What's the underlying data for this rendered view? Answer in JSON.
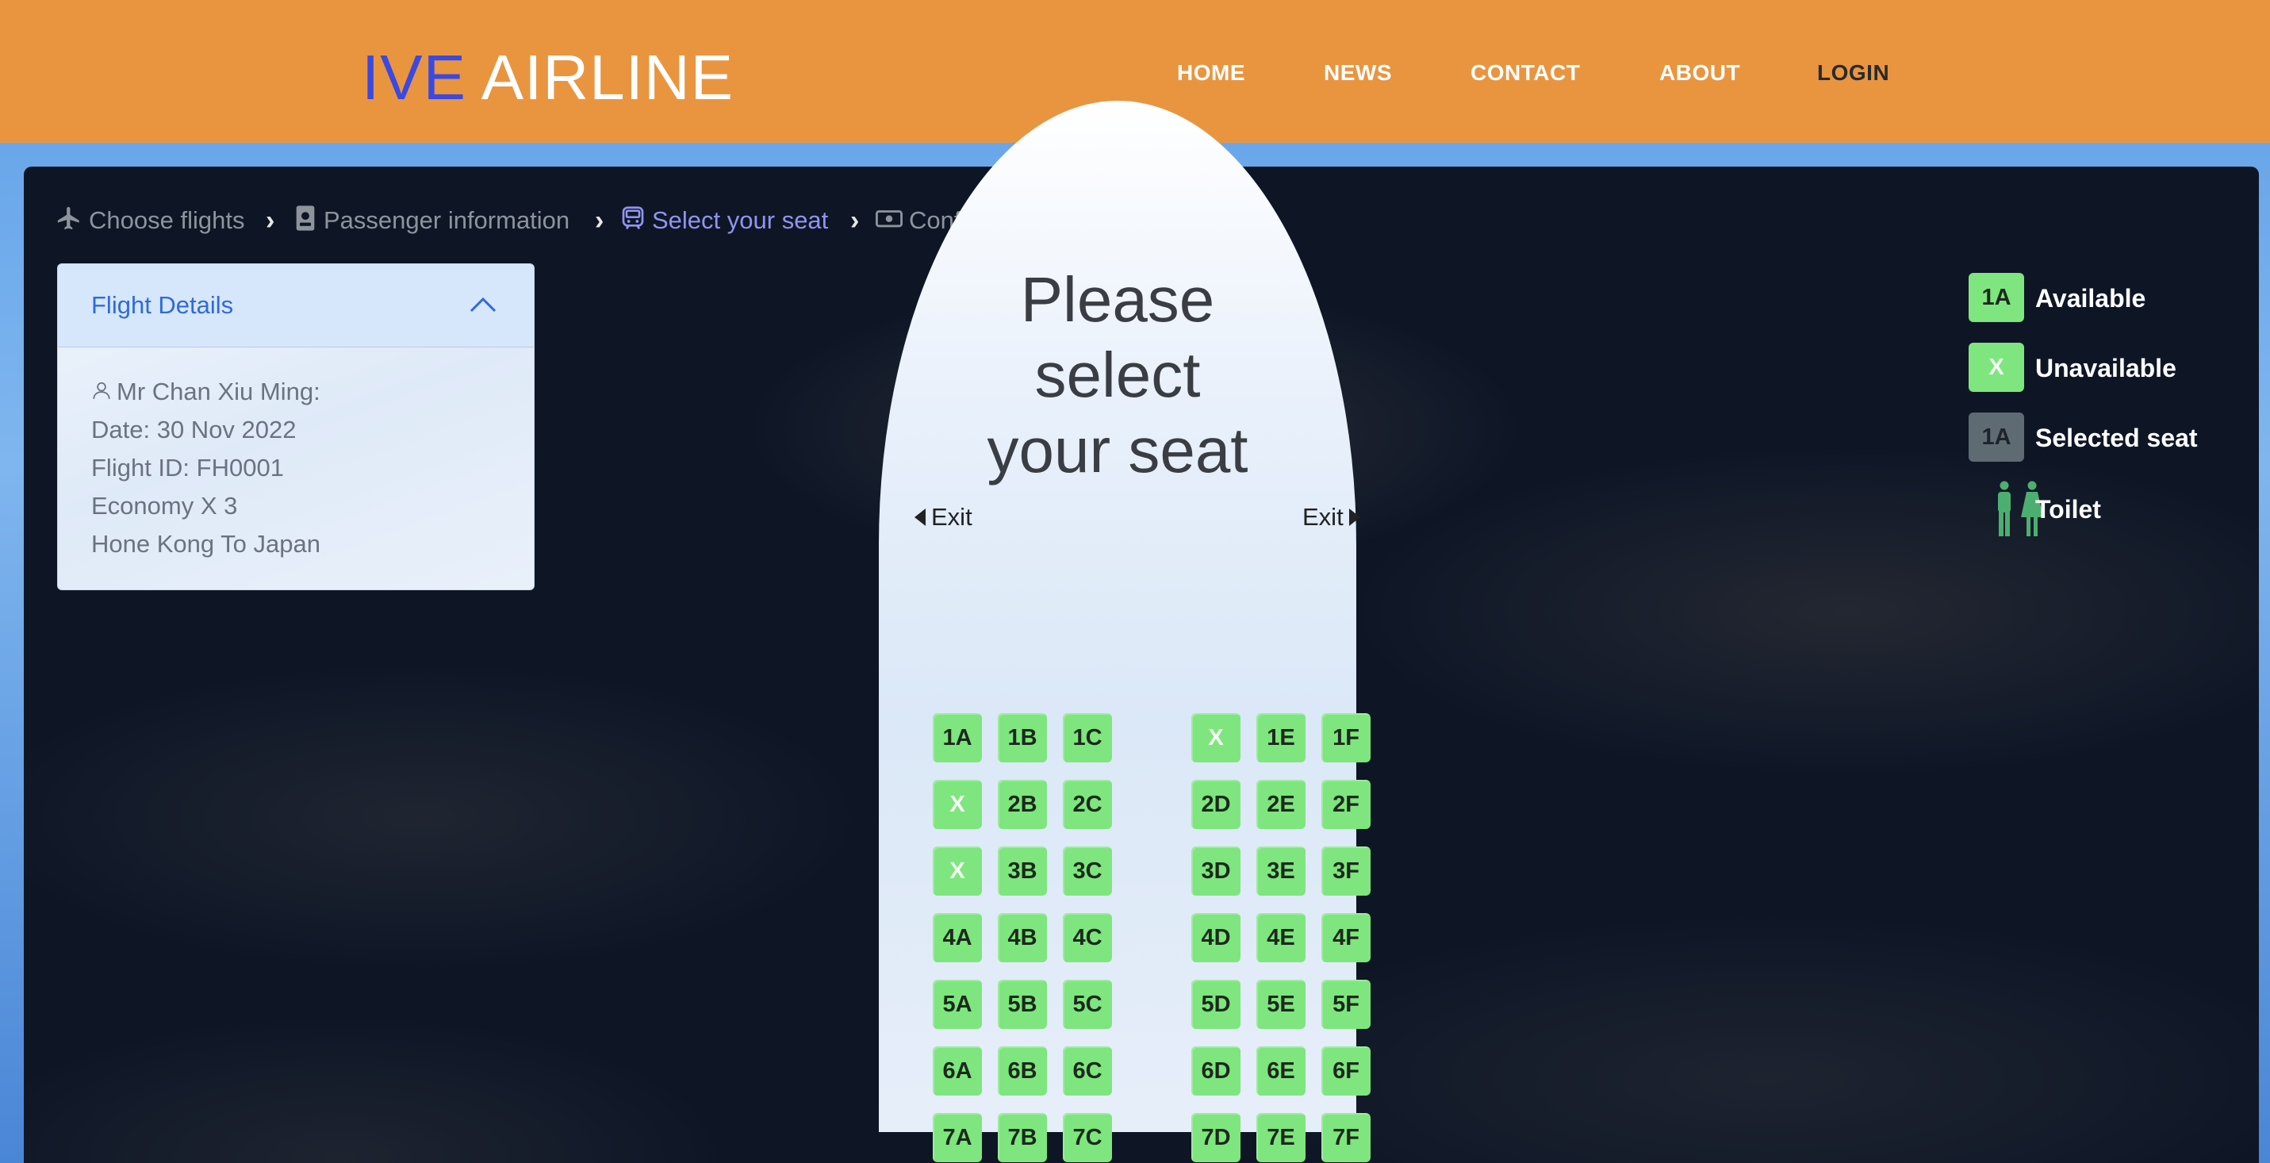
{
  "header": {
    "logo_accent": "IVE",
    "logo_rest": "AIRLINE",
    "nav": [
      "HOME",
      "NEWS",
      "CONTACT",
      "ABOUT",
      "LOGIN"
    ]
  },
  "breadcrumb": {
    "steps": [
      "Choose flights",
      "Passenger information",
      "Select your seat",
      "Confirm and pay"
    ],
    "active_step": "Select your seat"
  },
  "flight_details": {
    "title": "Flight Details",
    "passenger": "Mr Chan Xiu Ming:",
    "date": "Date: 30 Nov 2022",
    "flight_id": "Flight ID: FH0001",
    "class": "Economy X 3",
    "route": "Hone Kong To Japan"
  },
  "seat_map": {
    "heading_lines": [
      "Please",
      "select",
      "your seat"
    ],
    "exit_left": "Exit",
    "exit_right": "Exit",
    "rows": [
      [
        "1A",
        "1B",
        "1C",
        "X",
        "1E",
        "1F"
      ],
      [
        "X",
        "2B",
        "2C",
        "2D",
        "2E",
        "2F"
      ],
      [
        "X",
        "3B",
        "3C",
        "3D",
        "3E",
        "3F"
      ],
      [
        "4A",
        "4B",
        "4C",
        "4D",
        "4E",
        "4F"
      ],
      [
        "5A",
        "5B",
        "5C",
        "5D",
        "5E",
        "5F"
      ],
      [
        "6A",
        "6B",
        "6C",
        "6D",
        "6E",
        "6F"
      ],
      [
        "7A",
        "7B",
        "7C",
        "7D",
        "7E",
        "7F"
      ]
    ]
  },
  "legend": {
    "available_sample": "1A",
    "available_label": "Available",
    "unavailable_sample": "X",
    "unavailable_label": "Unavailable",
    "selected_sample": "1A",
    "selected_label": "Selected seat",
    "toilet_label": "Toilet"
  },
  "colors": {
    "header_bg": "#e99540",
    "logo_accent": "#3b49e0",
    "seat_available": "#7fe57f",
    "seat_selected": "#5f6b73",
    "breadcrumb_active": "#8f95ee",
    "toilet_icon": "#4caf70"
  },
  "icons": {
    "step1": "airplane-icon",
    "step2": "passport-icon",
    "step3": "train-seat-icon",
    "step4": "cash-icon",
    "card_toggle": "chevron-up-icon",
    "passenger": "person-icon",
    "exit_left": "caret-left-icon",
    "exit_right": "caret-right-icon",
    "toilet": "restroom-icon"
  }
}
